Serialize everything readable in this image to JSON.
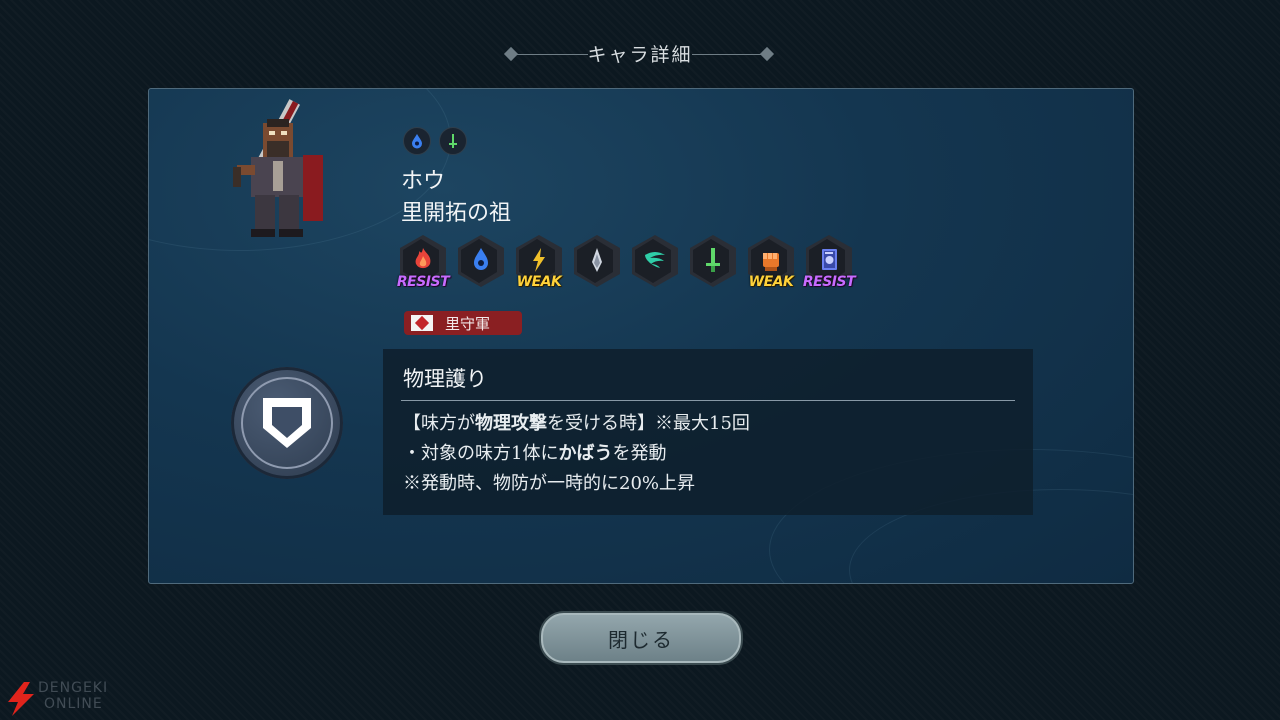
{
  "header": {
    "title": "キャラ詳細"
  },
  "character": {
    "name": "ホウ",
    "title": "里開拓の祖",
    "top_icons": [
      "water-element-icon",
      "sword-weapon-icon"
    ]
  },
  "resistances": [
    {
      "icon": "fire-icon",
      "tag": "RESIST",
      "tag_type": "resist",
      "color": "#e8443a"
    },
    {
      "icon": "water-icon",
      "tag": "",
      "tag_type": "none",
      "color": "#3a7ff0"
    },
    {
      "icon": "lightning-icon",
      "tag": "WEAK",
      "tag_type": "weak",
      "color": "#f0c02a"
    },
    {
      "icon": "ice-icon",
      "tag": "",
      "tag_type": "none",
      "color": "#d0d6e0"
    },
    {
      "icon": "wind-icon",
      "tag": "",
      "tag_type": "none",
      "color": "#2fcfa8"
    },
    {
      "icon": "sword-icon",
      "tag": "",
      "tag_type": "none",
      "color": "#5fd86a"
    },
    {
      "icon": "fist-icon",
      "tag": "WEAK",
      "tag_type": "weak",
      "color": "#e8782a"
    },
    {
      "icon": "magic-tome-icon",
      "tag": "RESIST",
      "tag_type": "resist",
      "color": "#6a7ff0"
    }
  ],
  "faction": {
    "label": "里守軍"
  },
  "skill": {
    "name": "物理護り",
    "line1_a": "【味方が",
    "line1_b": "物理攻撃",
    "line1_c": "を受ける時】※最大15回",
    "line2_a": "・対象の味方1体に",
    "line2_b": "かばう",
    "line2_c": "を発動",
    "line3": "※発動時、物防が一時的に20%上昇"
  },
  "buttons": {
    "close": "閉じる"
  },
  "watermark": {
    "line1": "DENGEKI",
    "line2": "ONLINE"
  }
}
